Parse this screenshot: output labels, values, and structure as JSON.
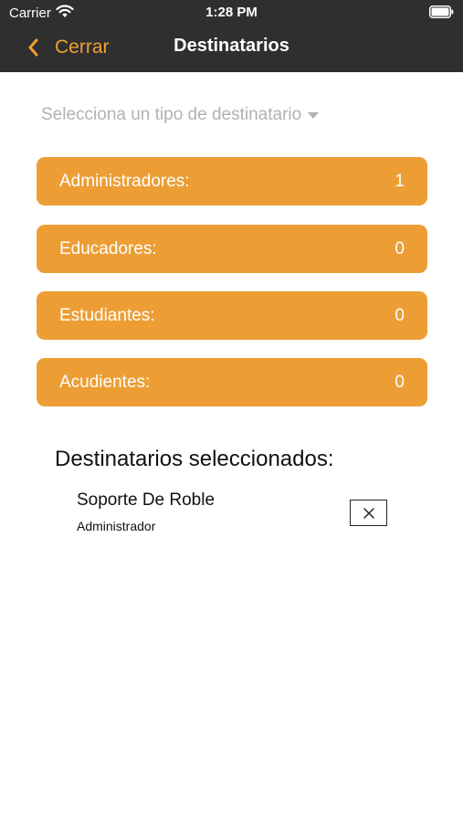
{
  "status_bar": {
    "carrier": "Carrier",
    "time": "1:28 PM"
  },
  "nav": {
    "back_label": "Cerrar",
    "title": "Destinatarios"
  },
  "type_select": {
    "placeholder": "Selecciona un tipo de destinatario"
  },
  "groups": [
    {
      "label": "Administradores:",
      "count": "1"
    },
    {
      "label": "Educadores:",
      "count": "0"
    },
    {
      "label": "Estudiantes:",
      "count": "0"
    },
    {
      "label": "Acudientes:",
      "count": "0"
    }
  ],
  "selected": {
    "heading": "Destinatarios seleccionados:",
    "recipients": [
      {
        "name": "Soporte De Roble",
        "role": "Administrador"
      }
    ]
  },
  "colors": {
    "header": "#2f2f2f",
    "accent": "#ec9e35",
    "placeholder": "#b1b1b1"
  },
  "icons": [
    "wifi-icon",
    "battery-icon",
    "chevron-left-icon",
    "caret-down-icon",
    "close-icon"
  ]
}
